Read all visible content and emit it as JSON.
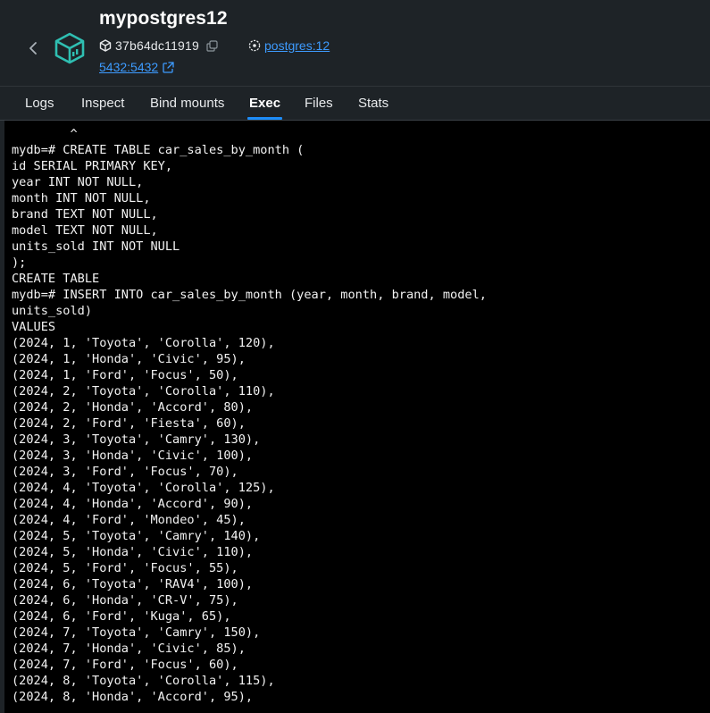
{
  "header": {
    "title": "mypostgres12",
    "container_id": "37b64dc11919",
    "image_link": "postgres:12",
    "port_link": "5432:5432",
    "accent_color": "#2fbfb2",
    "link_color": "#3d9bff"
  },
  "icons": {
    "back": "chevron-left-icon",
    "container": "container-cube-icon",
    "id": "cube-icon",
    "copy": "copy-icon",
    "image": "image-layers-icon",
    "external": "external-link-icon"
  },
  "tabs": [
    {
      "label": "Logs",
      "active": false
    },
    {
      "label": "Inspect",
      "active": false
    },
    {
      "label": "Bind mounts",
      "active": false
    },
    {
      "label": "Exec",
      "active": true
    },
    {
      "label": "Files",
      "active": false
    },
    {
      "label": "Stats",
      "active": false
    }
  ],
  "terminal": {
    "lines": [
      "        ^",
      "mydb=# CREATE TABLE car_sales_by_month (",
      "id SERIAL PRIMARY KEY,",
      "year INT NOT NULL,",
      "month INT NOT NULL,",
      "brand TEXT NOT NULL,",
      "model TEXT NOT NULL,",
      "units_sold INT NOT NULL",
      ");",
      "CREATE TABLE",
      "mydb=# INSERT INTO car_sales_by_month (year, month, brand, model,",
      "units_sold)",
      "VALUES",
      "(2024, 1, 'Toyota', 'Corolla', 120),",
      "(2024, 1, 'Honda', 'Civic', 95),",
      "(2024, 1, 'Ford', 'Focus', 50),",
      "(2024, 2, 'Toyota', 'Corolla', 110),",
      "(2024, 2, 'Honda', 'Accord', 80),",
      "(2024, 2, 'Ford', 'Fiesta', 60),",
      "(2024, 3, 'Toyota', 'Camry', 130),",
      "(2024, 3, 'Honda', 'Civic', 100),",
      "(2024, 3, 'Ford', 'Focus', 70),",
      "(2024, 4, 'Toyota', 'Corolla', 125),",
      "(2024, 4, 'Honda', 'Accord', 90),",
      "(2024, 4, 'Ford', 'Mondeo', 45),",
      "(2024, 5, 'Toyota', 'Camry', 140),",
      "(2024, 5, 'Honda', 'Civic', 110),",
      "(2024, 5, 'Ford', 'Focus', 55),",
      "(2024, 6, 'Toyota', 'RAV4', 100),",
      "(2024, 6, 'Honda', 'CR-V', 75),",
      "(2024, 6, 'Ford', 'Kuga', 65),",
      "(2024, 7, 'Toyota', 'Camry', 150),",
      "(2024, 7, 'Honda', 'Civic', 85),",
      "(2024, 7, 'Ford', 'Focus', 60),",
      "(2024, 8, 'Toyota', 'Corolla', 115),",
      "(2024, 8, 'Honda', 'Accord', 95),"
    ]
  }
}
